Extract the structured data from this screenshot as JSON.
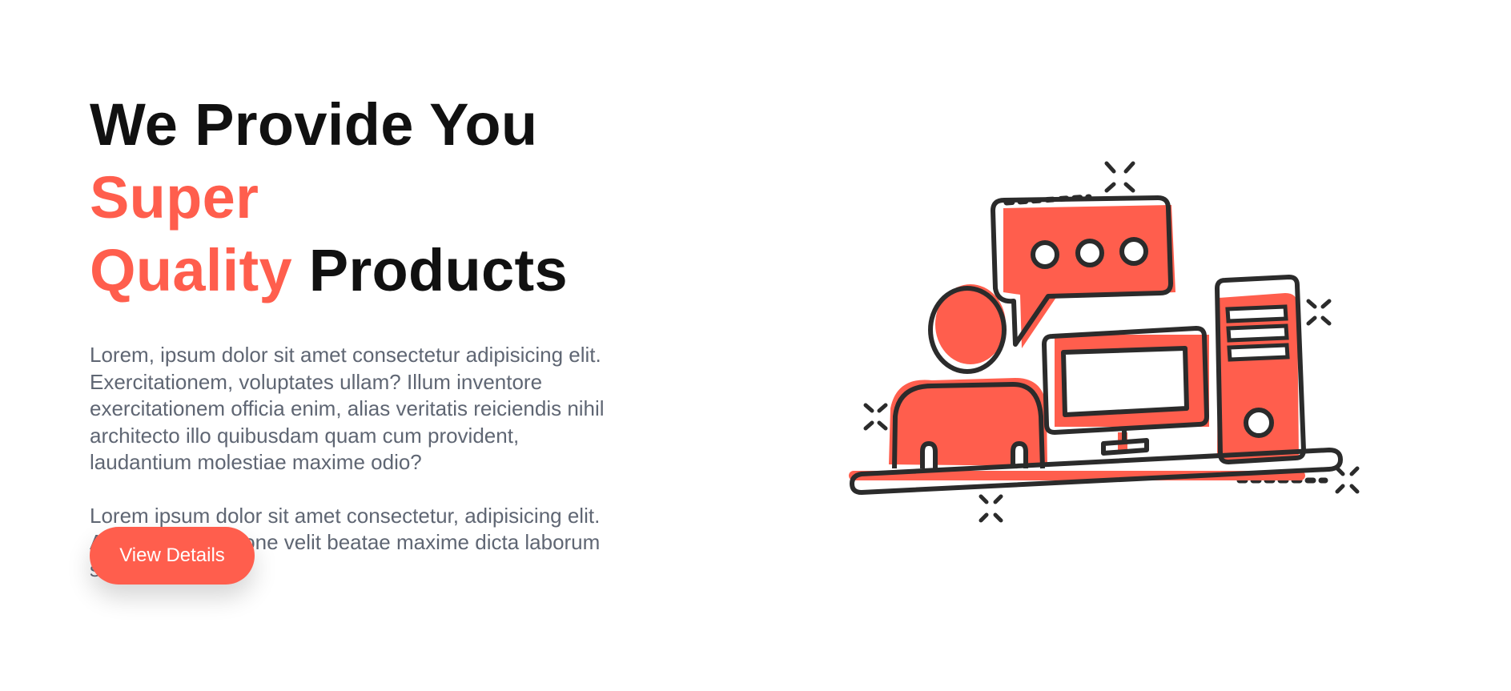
{
  "hero": {
    "title_part1": "We Provide You ",
    "title_accent1": "Super",
    "title_accent2": "Quality",
    "title_part2": " Products",
    "paragraph1": "Lorem, ipsum dolor sit amet consectetur adipisicing elit. Exercitationem, voluptates ullam? Illum inventore exercitationem officia enim, alias veritatis reiciendis nihil architecto illo quibusdam quam cum provident, laudantium molestiae maxime odio?",
    "paragraph2": "Lorem ipsum dolor sit amet consectetur, adipisicing elit. Accusantium ratione velit beatae maxime dicta laborum saepe.",
    "cta_label": "View Details"
  },
  "colors": {
    "accent": "#ff5e4d",
    "heading": "#111111",
    "body_text": "#5f6673",
    "outline": "#2b2b2b"
  },
  "illustration": {
    "icon": "customer-support-computer-illustration"
  }
}
